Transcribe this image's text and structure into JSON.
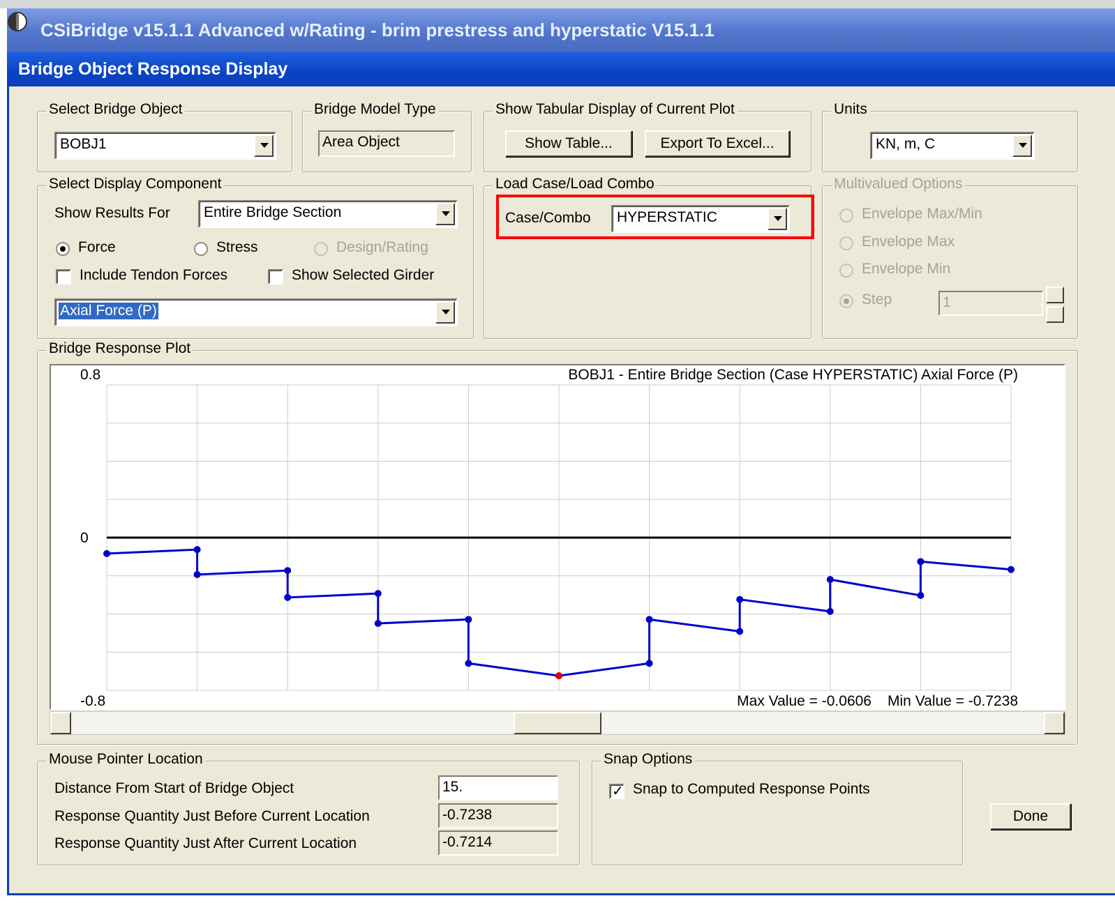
{
  "app": {
    "title": "CSiBridge v15.1.1 Advanced w/Rating  - brim prestress and hyperstatic V15.1.1"
  },
  "dialog": {
    "title": "Bridge Object Response Display"
  },
  "bridge_object": {
    "label": "Select Bridge Object",
    "value": "BOBJ1"
  },
  "model_type": {
    "label": "Bridge Model Type",
    "value": "Area Object"
  },
  "tabular": {
    "label": "Show Tabular Display of Current Plot",
    "show_table": "Show Table...",
    "export": "Export To Excel..."
  },
  "units": {
    "label": "Units",
    "value": "KN, m, C"
  },
  "display_component": {
    "label": "Select Display Component",
    "show_results_label": "Show Results For",
    "show_results_value": "Entire Bridge Section",
    "force": "Force",
    "stress": "Stress",
    "design": "Design/Rating",
    "include_tendon": "Include Tendon Forces",
    "show_girder": "Show Selected Girder",
    "quantity": "Axial Force  (P)"
  },
  "load_case": {
    "label": "Load Case/Load Combo",
    "case_label": "Case/Combo",
    "case_value": "HYPERSTATIC"
  },
  "multivalued": {
    "label": "Multivalued Options",
    "envelope_maxmin": "Envelope Max/Min",
    "envelope_max": "Envelope Max",
    "envelope_min": "Envelope Min",
    "step": "Step",
    "step_value": "1"
  },
  "plot": {
    "label": "Bridge Response Plot",
    "header": "BOBJ1 - Entire Bridge Section   (Case HYPERSTATIC)   Axial Force  (P)",
    "ymax_label": "0.8",
    "yzero_label": "0",
    "ymin_label": "-0.8",
    "max_value": "Max Value = -0.0606",
    "min_value": "Min Value = -0.7238"
  },
  "chart_data": {
    "type": "line",
    "x": [
      0,
      3,
      3,
      6,
      6,
      9,
      9,
      12,
      12,
      15,
      18,
      18,
      21,
      21,
      24,
      24,
      27,
      27,
      30
    ],
    "series": [
      {
        "values": [
          -0.0836,
          -0.0627,
          -0.1934,
          -0.1725,
          -0.3136,
          -0.2927,
          -0.4495,
          -0.4286,
          -0.6586,
          -0.7238,
          -0.6586,
          -0.4286,
          -0.4913,
          -0.324,
          -0.3867,
          -0.2195,
          -0.3031,
          -0.1254,
          -0.1672
        ]
      }
    ],
    "highlight_point": {
      "x": 15,
      "y": -0.7238
    },
    "ylim": [
      -0.8,
      0.8
    ],
    "xlim": [
      0,
      30
    ],
    "grid": true,
    "colors": {
      "series": "#0000cc",
      "highlight": "#dd0000",
      "axis": "#000000",
      "grid": "#cccccc"
    }
  },
  "mouse_location": {
    "label": "Mouse Pointer Location",
    "distance_label": "Distance From Start of Bridge Object",
    "distance_value": "15.",
    "before_label": "Response Quantity Just Before Current Location",
    "before_value": "-0.7238",
    "after_label": "Response Quantity Just After Current Location",
    "after_value": "-0.7214"
  },
  "snap": {
    "label": "Snap Options",
    "snap_label": "Snap to Computed Response Points"
  },
  "done": "Done"
}
